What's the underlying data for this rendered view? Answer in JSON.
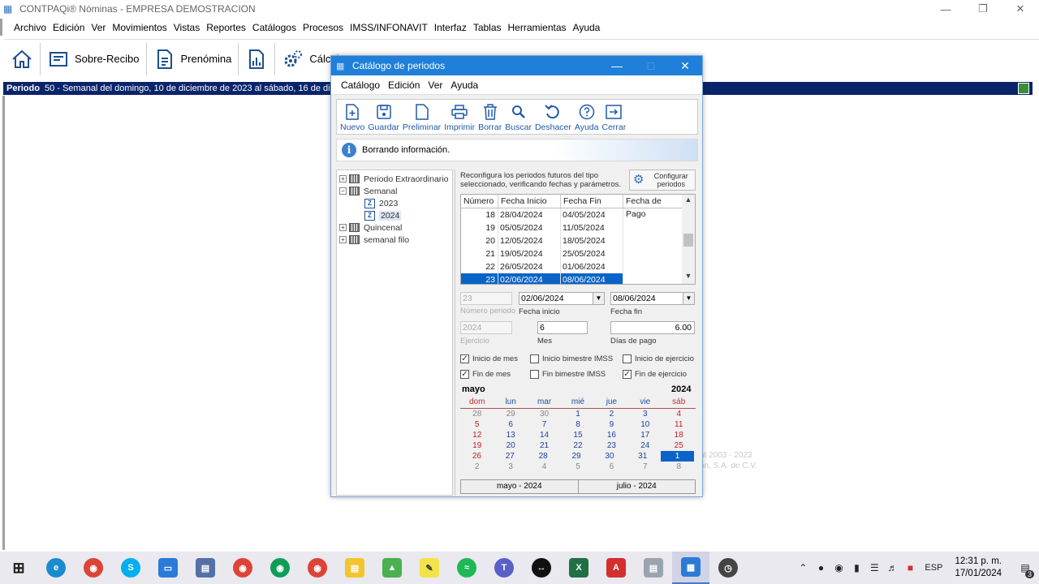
{
  "app": {
    "title": "CONTPAQi® Nóminas - EMPRESA DEMOSTRACION",
    "menu": [
      "Archivo",
      "Edición",
      "Ver",
      "Movimientos",
      "Vistas",
      "Reportes",
      "Catálogos",
      "Procesos",
      "IMSS/INFONAVIT",
      "Interfaz",
      "Tablas",
      "Herramientas",
      "Ayuda"
    ],
    "toolbar": {
      "sobre_recibo": "Sobre-Recibo",
      "prenomina": "Prenómina",
      "calculo": "Cálcul"
    },
    "period_label": "Periodo",
    "period_text": "50 - Semanal del domingo, 10 de diciembre de 2023 al sábado, 16 de diciemb",
    "watermark_line1": "ht 2003 - 2023",
    "watermark_line2": "ón, S.A. de C.V."
  },
  "dialog": {
    "title": "Catálogo de periodos",
    "menu": [
      "Catálogo",
      "Edición",
      "Ver",
      "Ayuda"
    ],
    "tools": [
      "Nuevo",
      "Guardar",
      "Preliminar",
      "Imprimir",
      "Borrar",
      "Buscar",
      "Deshacer",
      "Ayuda",
      "Cerrar"
    ],
    "info": "Borrando información.",
    "tree": {
      "extraordinario": "Periodo Extraordinario",
      "semanal": "Semanal",
      "y2023": "2023",
      "y2024": "2024",
      "quincenal": "Quincenal",
      "semanal_filo": "semanal filo"
    },
    "reconfig_text": "Reconfigura los periodos futuros del tipo seleccionado, verificando fechas y parámetros.",
    "config_button": "Configurar periodos",
    "grid": {
      "headers": [
        "Número",
        "Fecha Inicio",
        "Fecha Fin",
        "Fecha de Pago"
      ],
      "rows": [
        [
          "18",
          "28/04/2024",
          "04/05/2024",
          ""
        ],
        [
          "19",
          "05/05/2024",
          "11/05/2024",
          ""
        ],
        [
          "20",
          "12/05/2024",
          "18/05/2024",
          ""
        ],
        [
          "21",
          "19/05/2024",
          "25/05/2024",
          ""
        ],
        [
          "22",
          "26/05/2024",
          "01/06/2024",
          ""
        ],
        [
          "23",
          "02/06/2024",
          "08/06/2024",
          ""
        ]
      ],
      "selected_row": 5
    },
    "form": {
      "numero_periodo": "23",
      "numero_periodo_label": "Número periodo",
      "fecha_inicio": "02/06/2024",
      "fecha_inicio_label": "Fecha inicio",
      "fecha_fin": "08/06/2024",
      "fecha_fin_label": "Fecha fin",
      "ejercicio": "2024",
      "ejercicio_label": "Ejercicio",
      "mes": "6",
      "mes_label": "Mes",
      "dias_pago": "6.00",
      "dias_pago_label": "Días de pago"
    },
    "checks": [
      {
        "label": "Inicio de mes",
        "checked": true
      },
      {
        "label": "Inicio bimestre IMSS",
        "checked": false
      },
      {
        "label": "Inicio de ejercicio",
        "checked": false
      },
      {
        "label": "Fin de mes",
        "checked": true
      },
      {
        "label": "Fin bimestre IMSS",
        "checked": false
      },
      {
        "label": "Fin de ejercicio",
        "checked": true
      }
    ],
    "calendar": {
      "month": "mayo",
      "year": "2024",
      "days": [
        "dom",
        "lun",
        "mar",
        "mié",
        "jue",
        "vie",
        "sáb"
      ],
      "weeks": [
        [
          "28",
          "29",
          "30",
          "1",
          "2",
          "3",
          "4"
        ],
        [
          "5",
          "6",
          "7",
          "8",
          "9",
          "10",
          "11"
        ],
        [
          "12",
          "13",
          "14",
          "15",
          "16",
          "17",
          "18"
        ],
        [
          "19",
          "20",
          "21",
          "22",
          "23",
          "24",
          "25"
        ],
        [
          "26",
          "27",
          "28",
          "29",
          "30",
          "31",
          "1"
        ],
        [
          "2",
          "3",
          "4",
          "5",
          "6",
          "7",
          "8"
        ]
      ],
      "prev_nav": "mayo - 2024",
      "next_nav": "julio - 2024"
    }
  },
  "taskbar": {
    "lang": "ESP",
    "time": "12:31 p. m.",
    "date": "17/01/2024",
    "notif_count": "3"
  }
}
